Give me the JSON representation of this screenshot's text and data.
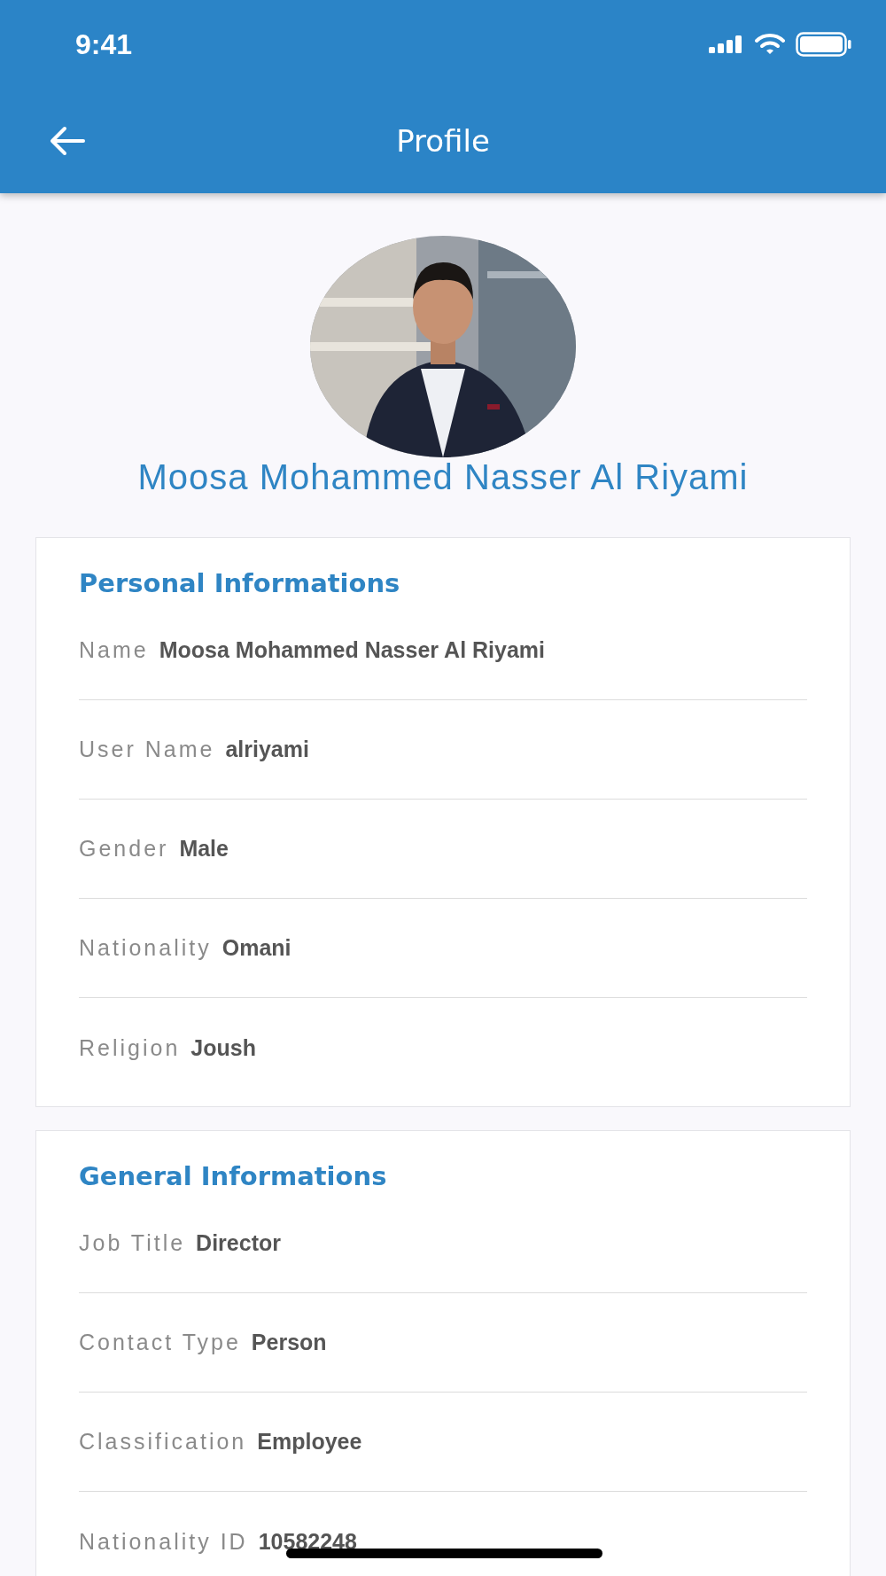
{
  "status_bar": {
    "time": "9:41"
  },
  "nav": {
    "title": "Profile"
  },
  "profile": {
    "name": "Moosa Mohammed Nasser Al Riyami"
  },
  "sections": [
    {
      "title": "Personal Informations",
      "fields": [
        {
          "label": "Name",
          "value": "Moosa Mohammed Nasser Al Riyami"
        },
        {
          "label": "User Name",
          "value": "alriyami"
        },
        {
          "label": "Gender",
          "value": "Male"
        },
        {
          "label": "Nationality",
          "value": "Omani"
        },
        {
          "label": "Religion",
          "value": "Joush"
        }
      ]
    },
    {
      "title": "General Informations",
      "fields": [
        {
          "label": "Job Title",
          "value": "Director"
        },
        {
          "label": "Contact Type",
          "value": "Person"
        },
        {
          "label": "Classification",
          "value": "Employee"
        },
        {
          "label": "Nationality ID",
          "value": "10582248"
        }
      ]
    }
  ]
}
